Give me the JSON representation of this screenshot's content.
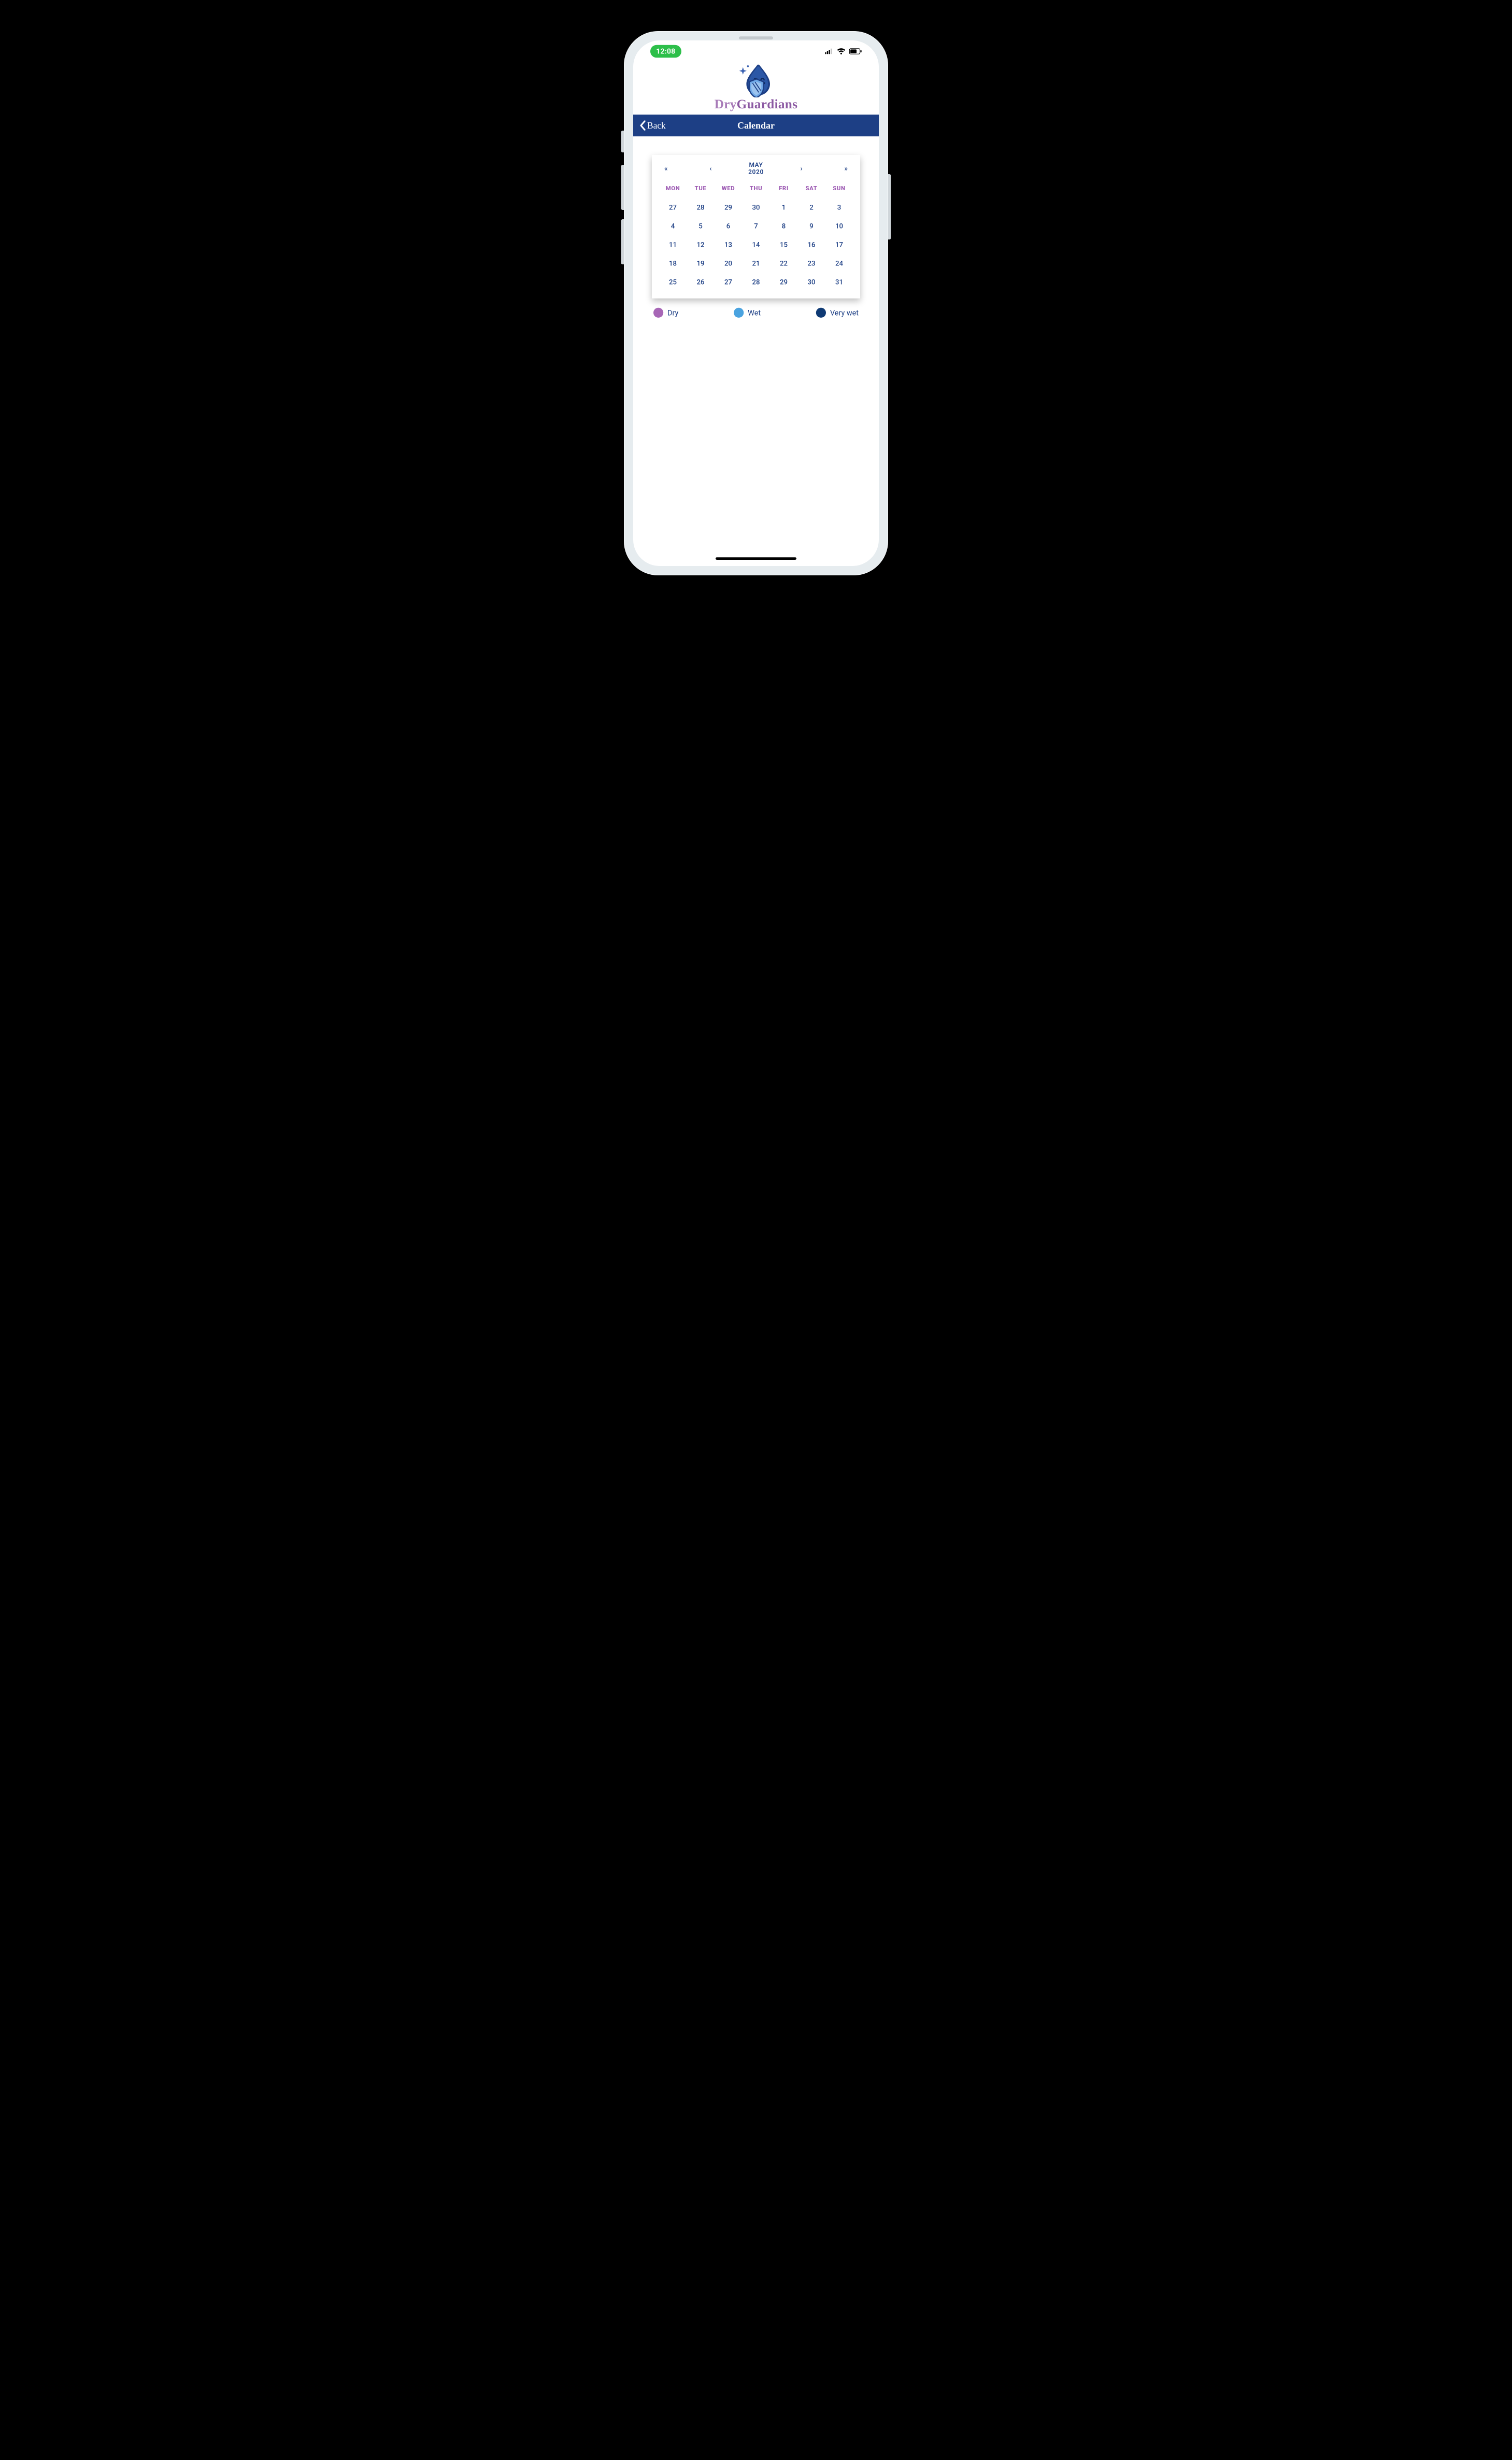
{
  "status": {
    "time": "12:08"
  },
  "brand": {
    "name_part1": "Dry",
    "name_part2": "Guardians"
  },
  "nav": {
    "back_label": "Back",
    "title": "Calendar"
  },
  "calendar": {
    "prev_year_glyph": "«",
    "prev_month_glyph": "‹",
    "next_month_glyph": "›",
    "next_year_glyph": "»",
    "month": "MAY",
    "year": "2020",
    "weekdays": [
      "MON",
      "TUE",
      "WED",
      "THU",
      "FRI",
      "SAT",
      "SUN"
    ],
    "weeks": [
      [
        "27",
        "28",
        "29",
        "30",
        "1",
        "2",
        "3"
      ],
      [
        "4",
        "5",
        "6",
        "7",
        "8",
        "9",
        "10"
      ],
      [
        "11",
        "12",
        "13",
        "14",
        "15",
        "16",
        "17"
      ],
      [
        "18",
        "19",
        "20",
        "21",
        "22",
        "23",
        "24"
      ],
      [
        "25",
        "26",
        "27",
        "28",
        "29",
        "30",
        "31"
      ]
    ]
  },
  "legend": {
    "items": [
      {
        "label": "Dry",
        "color": "#a766b6"
      },
      {
        "label": "Wet",
        "color": "#4aa3e0"
      },
      {
        "label": "Very wet",
        "color": "#0f3a74"
      }
    ]
  }
}
